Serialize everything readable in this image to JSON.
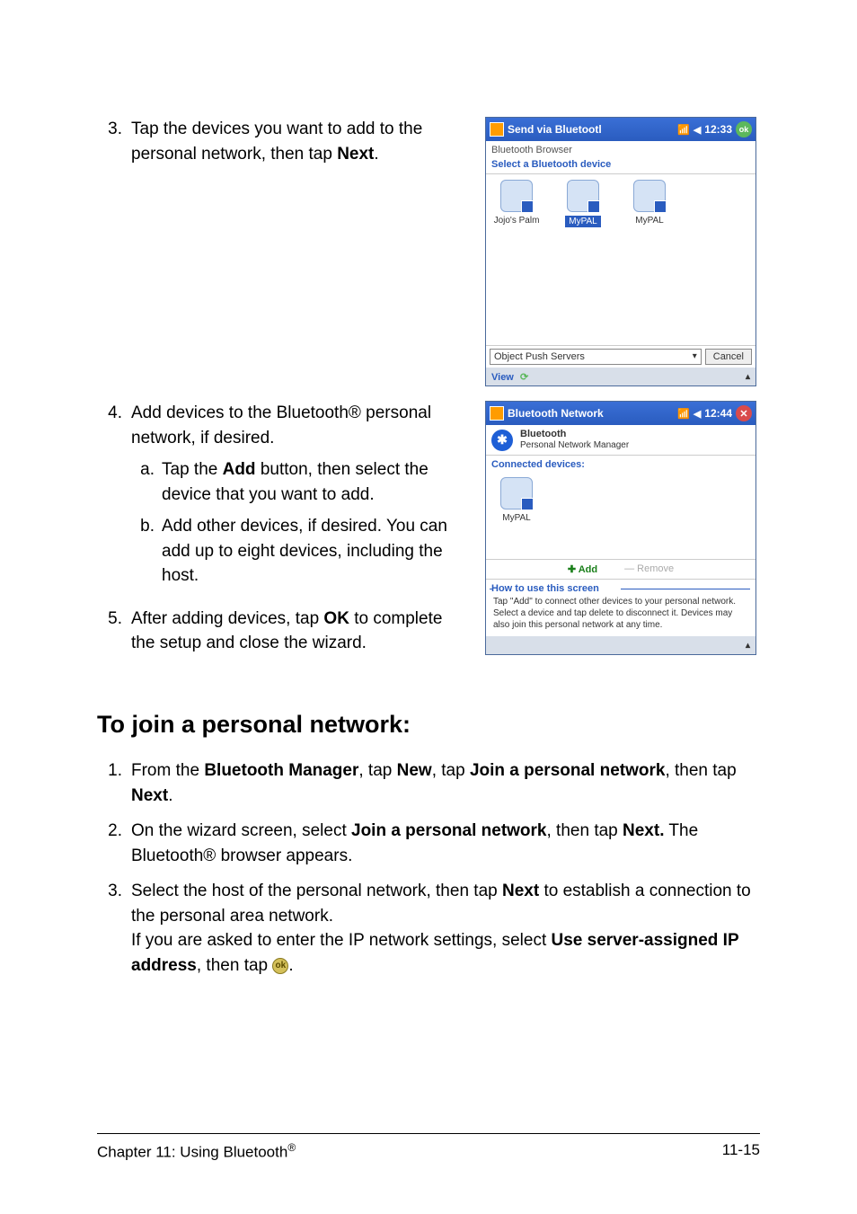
{
  "step3": {
    "num": "3.",
    "text_before": "Tap the devices you want to add to the personal network, then tap ",
    "text_bold": "Next",
    "text_after": "."
  },
  "step4": {
    "num": "4.",
    "text": "Add devices to the Bluetooth® personal network, if desired.",
    "sub_a": {
      "num": "a.",
      "before": "Tap the ",
      "bold": "Add",
      "after": " button, then select the device that you want to add."
    },
    "sub_b": {
      "num": "b.",
      "text": "Add other devices, if desired. You can add up to eight devices, including the host."
    }
  },
  "step5": {
    "num": "5.",
    "before": "After adding devices, tap ",
    "bold": "OK",
    "after": " to complete the setup and close the wizard."
  },
  "heading": "To join a personal network:",
  "join1": {
    "num": "1.",
    "t1": "From the ",
    "b1": "Bluetooth Manager",
    "t2": ", tap ",
    "b2": "New",
    "t3": ", tap ",
    "b3": "Join a personal network",
    "t4": ", then tap ",
    "b4": "Next",
    "t5": "."
  },
  "join2": {
    "num": "2.",
    "t1": "On the wizard screen, select ",
    "b1": "Join a personal network",
    "t2": ", then tap ",
    "b2": "Next.",
    "t3": " The Bluetooth® browser appears."
  },
  "join3": {
    "num": "3.",
    "t1": "Select the host of the personal network, then tap ",
    "b1": "Next",
    "t2": " to establish a connection to the personal area network.",
    "line2_t1": "If you are asked to enter the IP network settings, select ",
    "line2_b1": "Use server-assigned IP address",
    "line2_t2": ", then tap ",
    "ok_label": "ok",
    "line2_t3": "."
  },
  "footer": {
    "left_a": "Chapter 11: Using Bluetooth",
    "left_sup": "®",
    "right": "11-15"
  },
  "pda1": {
    "title": "Send via Bluetootl",
    "time": "12:33",
    "ok": "ok",
    "sub": "Bluetooth Browser",
    "link": "Select a Bluetooth device",
    "dev1": "Jojo's Palm",
    "dev2": "MyPAL",
    "dev3": "MyPAL",
    "dropdown": "Object Push Servers",
    "cancel": "Cancel",
    "view": "View"
  },
  "pda2": {
    "title": "Bluetooth Network",
    "time": "12:44",
    "header_t1": "Bluetooth",
    "header_t2": "Personal Network Manager",
    "connected": "Connected devices:",
    "dev": "MyPAL",
    "add": "Add",
    "remove": "Remove",
    "howto_head": "How to use this screen",
    "howto_body": "Tap \"Add\" to connect other devices to your personal network. Select a device and tap delete to disconnect it.\nDevices may also join this personal network at any time."
  }
}
